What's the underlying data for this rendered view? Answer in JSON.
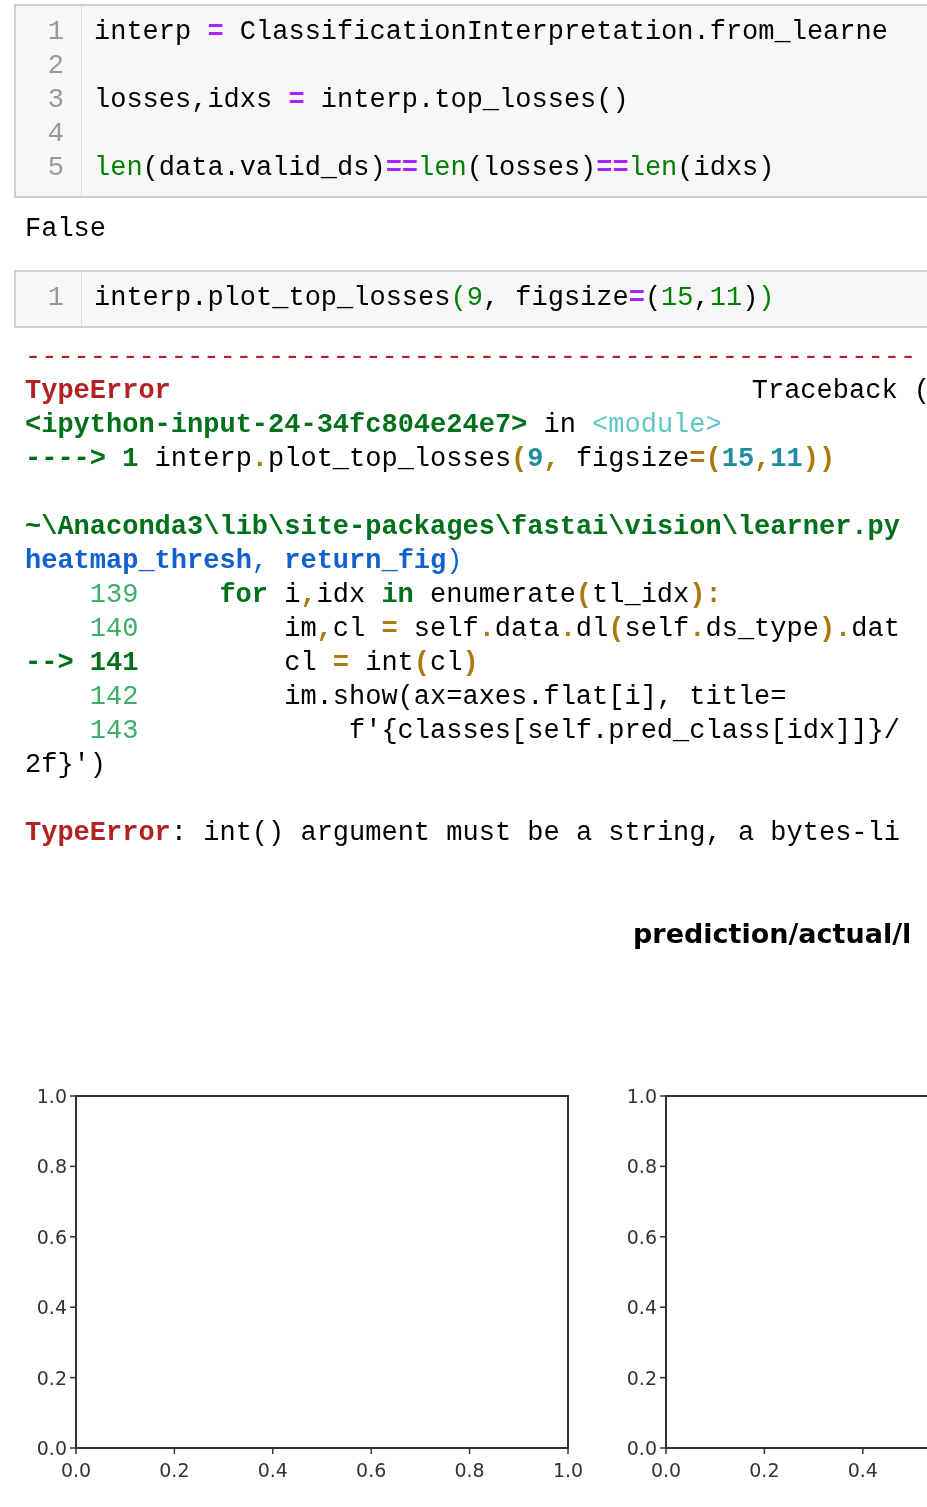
{
  "cells": [
    {
      "kind": "input",
      "lines": [
        {
          "number": "1",
          "tokens": [
            {
              "kind": "plain",
              "text": "interp "
            },
            {
              "kind": "op",
              "text": "="
            },
            {
              "kind": "plain",
              "text": " ClassificationInterpretation.from_learne"
            }
          ]
        },
        {
          "number": "2"
        },
        {
          "number": "3",
          "tokens": [
            {
              "kind": "plain",
              "text": "losses,idxs "
            },
            {
              "kind": "op",
              "text": "="
            },
            {
              "kind": "plain",
              "text": " interp.top_losses()"
            }
          ]
        },
        {
          "number": "4"
        },
        {
          "number": "5",
          "tokens": [
            {
              "kind": "builtin",
              "text": "len"
            },
            {
              "kind": "plain",
              "text": "(data.valid_ds)"
            },
            {
              "kind": "op",
              "text": "=="
            },
            {
              "kind": "builtin",
              "text": "len"
            },
            {
              "kind": "plain",
              "text": "(losses)"
            },
            {
              "kind": "op",
              "text": "=="
            },
            {
              "kind": "builtin",
              "text": "len"
            },
            {
              "kind": "plain",
              "text": "(idxs)"
            }
          ]
        }
      ],
      "output": "False"
    },
    {
      "kind": "input",
      "lines": [
        {
          "number": "1",
          "tokens": [
            {
              "kind": "plain",
              "text": "interp.plot_top_losses"
            },
            {
              "kind": "builtin",
              "text": "("
            },
            {
              "kind": "builtin",
              "text": "9"
            },
            {
              "kind": "plain",
              "text": ", figsize"
            },
            {
              "kind": "op",
              "text": "="
            },
            {
              "kind": "plain",
              "text": "("
            },
            {
              "kind": "builtin",
              "text": "15"
            },
            {
              "kind": "plain",
              "text": ","
            },
            {
              "kind": "builtin",
              "text": "11"
            },
            {
              "kind": "plain",
              "text": ")"
            },
            {
              "kind": "builtin",
              "text": ")"
            }
          ]
        }
      ]
    }
  ],
  "traceback": {
    "rule": "-------------------------------------------------------",
    "header": {
      "error": "TypeError",
      "label": "Traceback ("
    },
    "lines": [
      {
        "kind": "code",
        "tokens": [
          {
            "kind": "path",
            "text": "<ipython-input-24-34fc804e24e7>"
          },
          {
            "kind": "plain",
            "text": " in "
          },
          {
            "kind": "module",
            "text": "<module>"
          }
        ]
      },
      {
        "kind": "code",
        "tokens": [
          {
            "kind": "path",
            "text": "----> 1"
          },
          {
            "kind": "plain",
            "text": " interp"
          },
          {
            "kind": "punct",
            "text": "."
          },
          {
            "kind": "plain",
            "text": "plot_top_losses"
          },
          {
            "kind": "punct",
            "text": "("
          },
          {
            "kind": "num",
            "text": "9"
          },
          {
            "kind": "punct",
            "text": ","
          },
          {
            "kind": "plain",
            "text": " figsize"
          },
          {
            "kind": "punct",
            "text": "=("
          },
          {
            "kind": "num",
            "text": "15"
          },
          {
            "kind": "punct",
            "text": ","
          },
          {
            "kind": "num",
            "text": "11"
          },
          {
            "kind": "punct",
            "text": "))"
          }
        ]
      },
      {
        "kind": "blank"
      },
      {
        "kind": "code",
        "tokens": [
          {
            "kind": "path",
            "text": "~\\Anaconda3\\lib\\site-packages\\fastai\\vision\\learner.py"
          }
        ]
      },
      {
        "kind": "code",
        "tokens": [
          {
            "kind": "arg",
            "text": "heatmap_thresh"
          },
          {
            "kind": "argplain",
            "text": ", "
          },
          {
            "kind": "arg",
            "text": "return_fig"
          },
          {
            "kind": "argplain",
            "text": ")"
          }
        ]
      },
      {
        "kind": "source",
        "number": "139",
        "current": false,
        "tokens": [
          {
            "kind": "kw",
            "text": "for"
          },
          {
            "kind": "plain",
            "text": " i"
          },
          {
            "kind": "punct",
            "text": ","
          },
          {
            "kind": "plain",
            "text": "idx "
          },
          {
            "kind": "kw",
            "text": "in"
          },
          {
            "kind": "plain",
            "text": " enumerate"
          },
          {
            "kind": "punct",
            "text": "("
          },
          {
            "kind": "plain",
            "text": "tl_idx"
          },
          {
            "kind": "punct",
            "text": "):"
          }
        ],
        "children": [
          {
            "kind": "source",
            "number": "140",
            "current": false,
            "tokens": [
              {
                "kind": "plain",
                "text": "im"
              },
              {
                "kind": "punct",
                "text": ","
              },
              {
                "kind": "plain",
                "text": "cl "
              },
              {
                "kind": "punct",
                "text": "="
              },
              {
                "kind": "plain",
                "text": " self"
              },
              {
                "kind": "punct",
                "text": "."
              },
              {
                "kind": "plain",
                "text": "data"
              },
              {
                "kind": "punct",
                "text": "."
              },
              {
                "kind": "plain",
                "text": "dl"
              },
              {
                "kind": "punct",
                "text": "("
              },
              {
                "kind": "plain",
                "text": "self"
              },
              {
                "kind": "punct",
                "text": "."
              },
              {
                "kind": "plain",
                "text": "ds_type"
              },
              {
                "kind": "punct",
                "text": ")."
              },
              {
                "kind": "plain",
                "text": "dat"
              }
            ]
          },
          {
            "kind": "source",
            "marker": "-->",
            "number": "141",
            "current": true,
            "tokens": [
              {
                "kind": "plain",
                "text": "cl "
              },
              {
                "kind": "punct",
                "text": "="
              },
              {
                "kind": "plain",
                "text": " int"
              },
              {
                "kind": "punct",
                "text": "("
              },
              {
                "kind": "plain",
                "text": "cl"
              },
              {
                "kind": "punct",
                "text": ")"
              }
            ]
          },
          {
            "kind": "source",
            "number": "142",
            "current": false,
            "tokens": [
              {
                "kind": "plain",
                "text": "im.show(ax=axes.flat[i], title="
              }
            ],
            "children": [
              {
                "kind": "source",
                "number": "143",
                "current": false,
                "tokens": [
                  {
                    "kind": "plain",
                    "text": "f'{classes[self.pred_class[idx]]}/"
                  }
                ]
              }
            ]
          }
        ]
      },
      {
        "kind": "code",
        "tokens": [
          {
            "kind": "plain",
            "text": "2f}')"
          }
        ]
      },
      {
        "kind": "blank"
      },
      {
        "kind": "code",
        "tokens": [
          {
            "kind": "err",
            "text": "TypeError"
          },
          {
            "kind": "plain",
            "text": ": int() argument must be a string, a bytes-li"
          }
        ]
      }
    ]
  },
  "figure": {
    "title": "prediction/actual/l",
    "plots": [
      {
        "chart_data": {
          "type": "line",
          "xlim": [
            0,
            1
          ],
          "ylim": [
            0,
            1
          ],
          "xticks": [
            {
              "value": 0,
              "label": "0.0"
            },
            {
              "value": 0.2,
              "label": "0.2"
            },
            {
              "value": 0.4,
              "label": "0.4"
            },
            {
              "value": 0.6,
              "label": "0.6"
            },
            {
              "value": 0.8,
              "label": "0.8"
            },
            {
              "value": 1,
              "label": "1.0"
            }
          ],
          "yticks": [
            {
              "value": 0,
              "label": "0.0"
            },
            {
              "value": 0.2,
              "label": "0.2"
            },
            {
              "value": 0.4,
              "label": "0.4"
            },
            {
              "value": 0.6,
              "label": "0.6"
            },
            {
              "value": 0.8,
              "label": "0.8"
            },
            {
              "value": 1,
              "label": "1.0"
            }
          ]
        }
      },
      {
        "chart_data": {
          "type": "line",
          "xlim": [
            0,
            1
          ],
          "ylim": [
            0,
            1
          ],
          "xticks": [
            {
              "value": 0,
              "label": "0.0"
            },
            {
              "value": 0.2,
              "label": "0.2"
            },
            {
              "value": 0.4,
              "label": "0.4"
            }
          ],
          "yticks": [
            {
              "value": 0,
              "label": "0.0"
            },
            {
              "value": 0.2,
              "label": "0.2"
            },
            {
              "value": 0.4,
              "label": "0.4"
            },
            {
              "value": 0.6,
              "label": "0.6"
            },
            {
              "value": 0.8,
              "label": "0.8"
            },
            {
              "value": 1,
              "label": "1.0"
            }
          ]
        }
      }
    ]
  }
}
